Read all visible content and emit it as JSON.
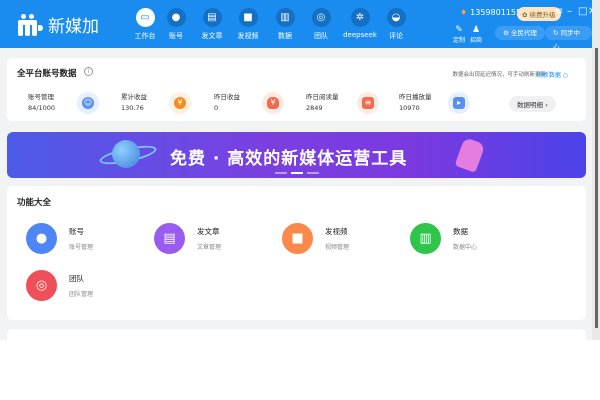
{
  "app": {
    "name": "新媒加"
  },
  "nav": [
    {
      "label": "工作台",
      "icon": "monitor-icon",
      "glyph": "▭"
    },
    {
      "label": "账号",
      "icon": "user-icon",
      "glyph": "●"
    },
    {
      "label": "发文章",
      "icon": "document-icon",
      "glyph": "▤"
    },
    {
      "label": "发视频",
      "icon": "video-icon",
      "glyph": "■"
    },
    {
      "label": "数据",
      "icon": "chart-icon",
      "glyph": "▥"
    },
    {
      "label": "团队",
      "icon": "team-icon",
      "glyph": "◎"
    },
    {
      "label": "deepseek",
      "icon": "deepseek-icon",
      "glyph": "✲"
    },
    {
      "label": "评论",
      "icon": "comment-icon",
      "glyph": "◒"
    }
  ],
  "user": {
    "phone": "13598011557",
    "upgrade": "续费升级"
  },
  "tools": {
    "customize": "定制",
    "gift": "招商",
    "agent": "全民代理",
    "sync": "同步中心"
  },
  "overview": {
    "title": "全平台账号数据",
    "hint": "数据会出现延迟情况，可手动刷新更新",
    "refresh": "刷新数据",
    "detail": "数据明细 ›",
    "stats": [
      {
        "label": "账号管理",
        "value": "84/1000"
      },
      {
        "label": "累计收益",
        "value": "130.76"
      },
      {
        "label": "昨日收益",
        "value": "0"
      },
      {
        "label": "昨日阅读量",
        "value": "2849"
      },
      {
        "label": "昨日播放量",
        "value": "10970"
      }
    ]
  },
  "banner": {
    "title": "免费 · 高效的新媒体运营工具"
  },
  "functions": {
    "title": "功能大全",
    "items": [
      {
        "title": "账号",
        "sub": "账号管理",
        "color": "#4f86f5"
      },
      {
        "title": "发文章",
        "sub": "文章管理",
        "color": "#9a5cf0"
      },
      {
        "title": "发视频",
        "sub": "视频管理",
        "color": "#fb8a4a"
      },
      {
        "title": "数据",
        "sub": "数据中心",
        "color": "#2fc44a"
      },
      {
        "title": "团队",
        "sub": "团队管理",
        "color": "#ef4f58"
      }
    ]
  }
}
